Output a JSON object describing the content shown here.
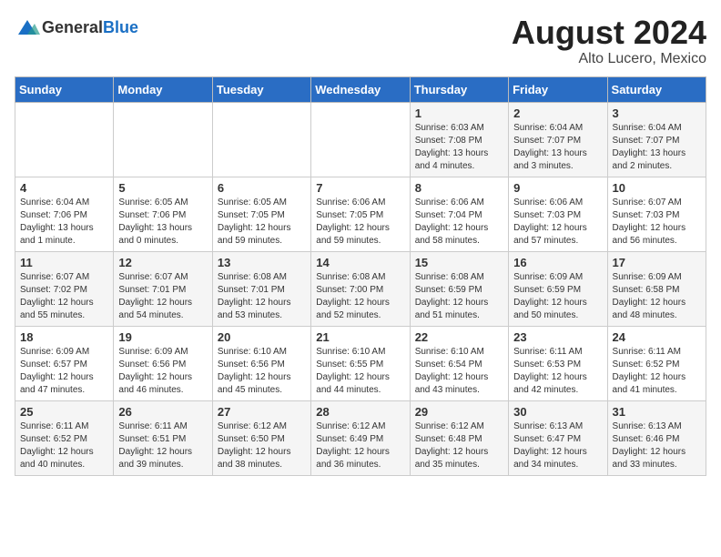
{
  "header": {
    "logo_general": "General",
    "logo_blue": "Blue",
    "month_year": "August 2024",
    "location": "Alto Lucero, Mexico"
  },
  "weekdays": [
    "Sunday",
    "Monday",
    "Tuesday",
    "Wednesday",
    "Thursday",
    "Friday",
    "Saturday"
  ],
  "weeks": [
    [
      {
        "day": "",
        "info": ""
      },
      {
        "day": "",
        "info": ""
      },
      {
        "day": "",
        "info": ""
      },
      {
        "day": "",
        "info": ""
      },
      {
        "day": "1",
        "info": "Sunrise: 6:03 AM\nSunset: 7:08 PM\nDaylight: 13 hours\nand 4 minutes."
      },
      {
        "day": "2",
        "info": "Sunrise: 6:04 AM\nSunset: 7:07 PM\nDaylight: 13 hours\nand 3 minutes."
      },
      {
        "day": "3",
        "info": "Sunrise: 6:04 AM\nSunset: 7:07 PM\nDaylight: 13 hours\nand 2 minutes."
      }
    ],
    [
      {
        "day": "4",
        "info": "Sunrise: 6:04 AM\nSunset: 7:06 PM\nDaylight: 13 hours\nand 1 minute."
      },
      {
        "day": "5",
        "info": "Sunrise: 6:05 AM\nSunset: 7:06 PM\nDaylight: 13 hours\nand 0 minutes."
      },
      {
        "day": "6",
        "info": "Sunrise: 6:05 AM\nSunset: 7:05 PM\nDaylight: 12 hours\nand 59 minutes."
      },
      {
        "day": "7",
        "info": "Sunrise: 6:06 AM\nSunset: 7:05 PM\nDaylight: 12 hours\nand 59 minutes."
      },
      {
        "day": "8",
        "info": "Sunrise: 6:06 AM\nSunset: 7:04 PM\nDaylight: 12 hours\nand 58 minutes."
      },
      {
        "day": "9",
        "info": "Sunrise: 6:06 AM\nSunset: 7:03 PM\nDaylight: 12 hours\nand 57 minutes."
      },
      {
        "day": "10",
        "info": "Sunrise: 6:07 AM\nSunset: 7:03 PM\nDaylight: 12 hours\nand 56 minutes."
      }
    ],
    [
      {
        "day": "11",
        "info": "Sunrise: 6:07 AM\nSunset: 7:02 PM\nDaylight: 12 hours\nand 55 minutes."
      },
      {
        "day": "12",
        "info": "Sunrise: 6:07 AM\nSunset: 7:01 PM\nDaylight: 12 hours\nand 54 minutes."
      },
      {
        "day": "13",
        "info": "Sunrise: 6:08 AM\nSunset: 7:01 PM\nDaylight: 12 hours\nand 53 minutes."
      },
      {
        "day": "14",
        "info": "Sunrise: 6:08 AM\nSunset: 7:00 PM\nDaylight: 12 hours\nand 52 minutes."
      },
      {
        "day": "15",
        "info": "Sunrise: 6:08 AM\nSunset: 6:59 PM\nDaylight: 12 hours\nand 51 minutes."
      },
      {
        "day": "16",
        "info": "Sunrise: 6:09 AM\nSunset: 6:59 PM\nDaylight: 12 hours\nand 50 minutes."
      },
      {
        "day": "17",
        "info": "Sunrise: 6:09 AM\nSunset: 6:58 PM\nDaylight: 12 hours\nand 48 minutes."
      }
    ],
    [
      {
        "day": "18",
        "info": "Sunrise: 6:09 AM\nSunset: 6:57 PM\nDaylight: 12 hours\nand 47 minutes."
      },
      {
        "day": "19",
        "info": "Sunrise: 6:09 AM\nSunset: 6:56 PM\nDaylight: 12 hours\nand 46 minutes."
      },
      {
        "day": "20",
        "info": "Sunrise: 6:10 AM\nSunset: 6:56 PM\nDaylight: 12 hours\nand 45 minutes."
      },
      {
        "day": "21",
        "info": "Sunrise: 6:10 AM\nSunset: 6:55 PM\nDaylight: 12 hours\nand 44 minutes."
      },
      {
        "day": "22",
        "info": "Sunrise: 6:10 AM\nSunset: 6:54 PM\nDaylight: 12 hours\nand 43 minutes."
      },
      {
        "day": "23",
        "info": "Sunrise: 6:11 AM\nSunset: 6:53 PM\nDaylight: 12 hours\nand 42 minutes."
      },
      {
        "day": "24",
        "info": "Sunrise: 6:11 AM\nSunset: 6:52 PM\nDaylight: 12 hours\nand 41 minutes."
      }
    ],
    [
      {
        "day": "25",
        "info": "Sunrise: 6:11 AM\nSunset: 6:52 PM\nDaylight: 12 hours\nand 40 minutes."
      },
      {
        "day": "26",
        "info": "Sunrise: 6:11 AM\nSunset: 6:51 PM\nDaylight: 12 hours\nand 39 minutes."
      },
      {
        "day": "27",
        "info": "Sunrise: 6:12 AM\nSunset: 6:50 PM\nDaylight: 12 hours\nand 38 minutes."
      },
      {
        "day": "28",
        "info": "Sunrise: 6:12 AM\nSunset: 6:49 PM\nDaylight: 12 hours\nand 36 minutes."
      },
      {
        "day": "29",
        "info": "Sunrise: 6:12 AM\nSunset: 6:48 PM\nDaylight: 12 hours\nand 35 minutes."
      },
      {
        "day": "30",
        "info": "Sunrise: 6:13 AM\nSunset: 6:47 PM\nDaylight: 12 hours\nand 34 minutes."
      },
      {
        "day": "31",
        "info": "Sunrise: 6:13 AM\nSunset: 6:46 PM\nDaylight: 12 hours\nand 33 minutes."
      }
    ]
  ]
}
